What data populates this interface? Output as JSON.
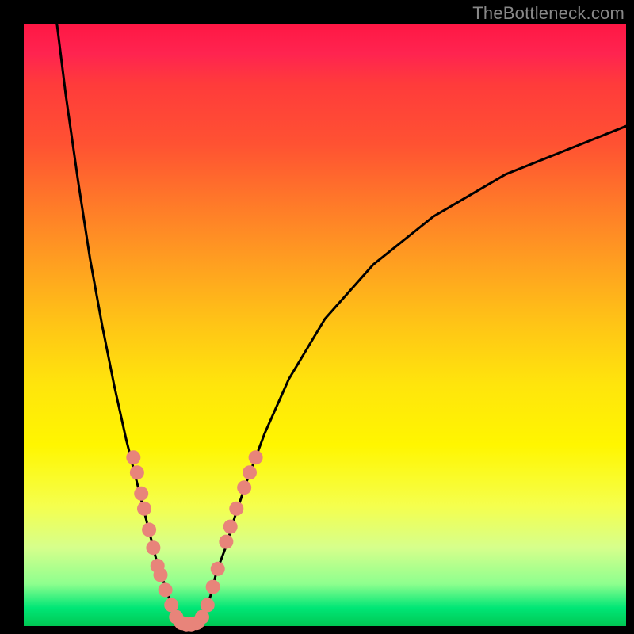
{
  "watermark": "TheBottleneck.com",
  "chart_data": {
    "type": "line",
    "title": "",
    "xlabel": "",
    "ylabel": "",
    "xlim": [
      0,
      100
    ],
    "ylim": [
      0,
      100
    ],
    "background_gradient": {
      "top": "#ff1744",
      "middle": "#ffe50c",
      "bottom": "#00c853"
    },
    "series": [
      {
        "name": "left-branch",
        "x": [
          5.5,
          7,
          9,
          11,
          13,
          15,
          17,
          18.5,
          20,
          21,
          22,
          23,
          24,
          25,
          25.7
        ],
        "y": [
          100,
          88,
          74,
          61,
          50,
          40,
          31,
          25,
          19,
          15,
          11,
          8,
          5,
          2.5,
          0.5
        ]
      },
      {
        "name": "right-branch",
        "x": [
          29.3,
          30,
          31,
          32,
          33.5,
          35,
          37,
          40,
          44,
          50,
          58,
          68,
          80,
          95,
          100
        ],
        "y": [
          0.5,
          2,
          5,
          9,
          13,
          18,
          24,
          32,
          41,
          51,
          60,
          68,
          75,
          81,
          83
        ]
      },
      {
        "name": "valley-floor",
        "x": [
          25.7,
          26.5,
          27.5,
          28.5,
          29.3
        ],
        "y": [
          0.5,
          0.3,
          0.3,
          0.3,
          0.5
        ]
      }
    ],
    "markers": {
      "name": "highlighted-points",
      "color": "#e8847a",
      "points": [
        {
          "x": 18.2,
          "y": 28
        },
        {
          "x": 18.8,
          "y": 25.5
        },
        {
          "x": 19.5,
          "y": 22
        },
        {
          "x": 20.0,
          "y": 19.5
        },
        {
          "x": 20.8,
          "y": 16
        },
        {
          "x": 21.5,
          "y": 13
        },
        {
          "x": 22.2,
          "y": 10
        },
        {
          "x": 22.7,
          "y": 8.5
        },
        {
          "x": 23.5,
          "y": 6
        },
        {
          "x": 24.5,
          "y": 3.5
        },
        {
          "x": 25.3,
          "y": 1.5
        },
        {
          "x": 26.2,
          "y": 0.5
        },
        {
          "x": 27.0,
          "y": 0.3
        },
        {
          "x": 27.8,
          "y": 0.3
        },
        {
          "x": 28.7,
          "y": 0.5
        },
        {
          "x": 29.6,
          "y": 1.5
        },
        {
          "x": 30.5,
          "y": 3.5
        },
        {
          "x": 31.4,
          "y": 6.5
        },
        {
          "x": 32.2,
          "y": 9.5
        },
        {
          "x": 33.6,
          "y": 14
        },
        {
          "x": 34.3,
          "y": 16.5
        },
        {
          "x": 35.3,
          "y": 19.5
        },
        {
          "x": 36.6,
          "y": 23
        },
        {
          "x": 37.5,
          "y": 25.5
        },
        {
          "x": 38.5,
          "y": 28
        }
      ]
    }
  }
}
